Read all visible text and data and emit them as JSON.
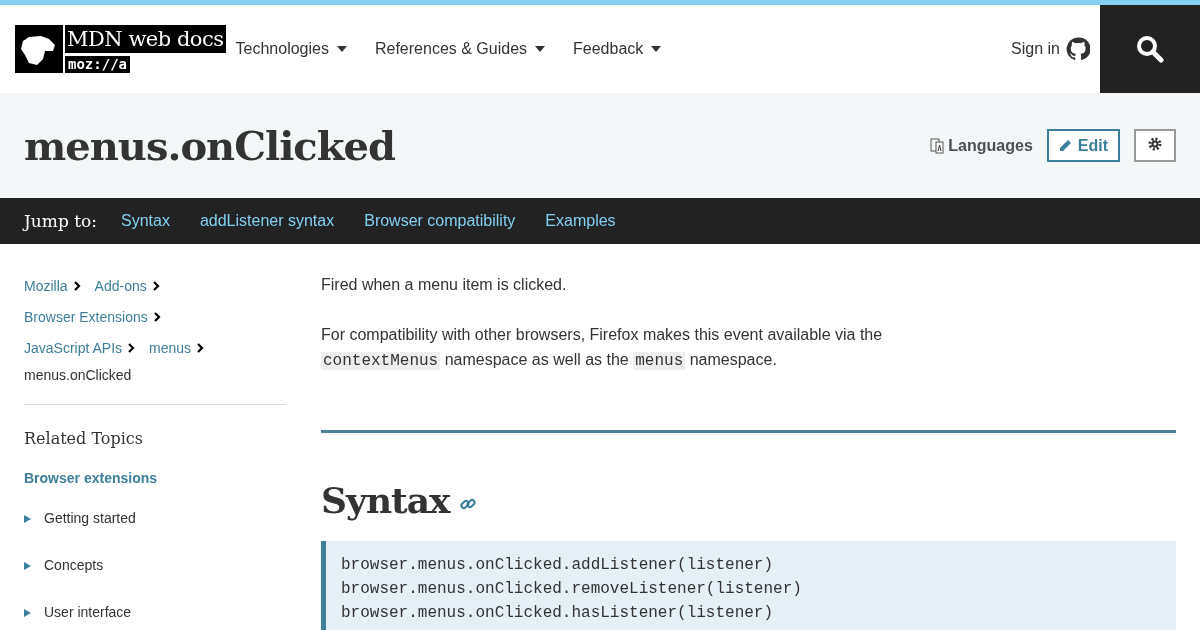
{
  "header": {
    "logo_text": "MDN web docs",
    "logo_sub": "moz://a",
    "nav": [
      {
        "label": "Technologies"
      },
      {
        "label": "References & Guides"
      },
      {
        "label": "Feedback"
      }
    ],
    "sign_in": "Sign in"
  },
  "page_title": "menus.onClicked",
  "actions": {
    "languages": "Languages",
    "edit": "Edit"
  },
  "jump": {
    "label": "Jump to:",
    "links": [
      "Syntax",
      "addListener syntax",
      "Browser compatibility",
      "Examples"
    ]
  },
  "breadcrumb_rows": [
    {
      "items": [
        {
          "label": "Mozilla",
          "kind": "link"
        },
        {
          "label": "Add-ons",
          "kind": "link"
        }
      ]
    },
    {
      "items": [
        {
          "label": "Browser Extensions",
          "kind": "link"
        }
      ]
    },
    {
      "items": [
        {
          "label": "JavaScript APIs",
          "kind": "link"
        },
        {
          "label": "menus",
          "kind": "link"
        }
      ]
    },
    {
      "items": [
        {
          "label": "menus.onClicked",
          "kind": "current"
        }
      ]
    }
  ],
  "related": {
    "title": "Related Topics",
    "section": "Browser extensions",
    "items": [
      {
        "label": "Getting started",
        "expanded": false
      },
      {
        "label": "Concepts",
        "expanded": false
      },
      {
        "label": "User interface",
        "expanded": false
      }
    ]
  },
  "intro": "Fired when a menu item is clicked.",
  "paragraph": [
    {
      "kind": "text",
      "text": "For compatibility with other browsers, Firefox makes this event available via the "
    },
    {
      "kind": "code",
      "text": "contextMenus"
    },
    {
      "kind": "text",
      "text": " namespace as well as the "
    },
    {
      "kind": "code",
      "text": "menus"
    },
    {
      "kind": "text",
      "text": " namespace."
    }
  ],
  "section_heading": "Syntax",
  "code_lines": [
    "browser.menus.onClicked.addListener(listener)",
    "browser.menus.onClicked.removeListener(listener)",
    "browser.menus.onClicked.hasListener(listener)"
  ]
}
